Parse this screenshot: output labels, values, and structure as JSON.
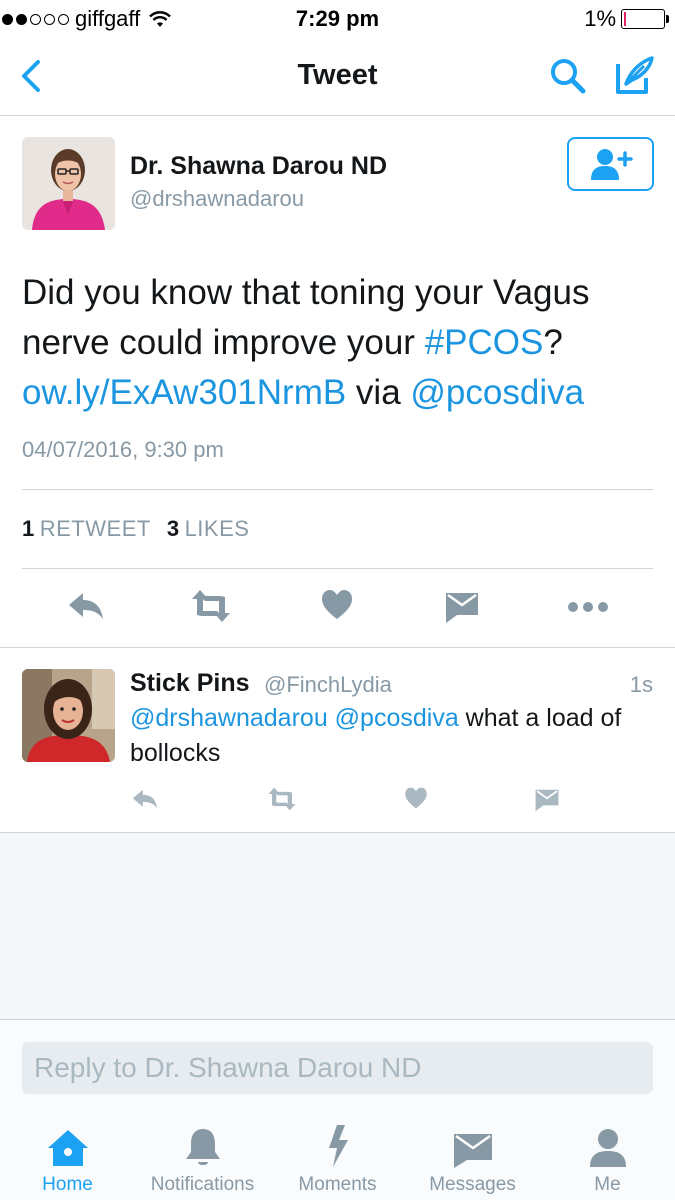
{
  "status_bar": {
    "carrier": "giffgaff",
    "signal_bars": 2,
    "time": "7:29 pm",
    "battery": "1%",
    "battery_level": 0.01
  },
  "nav": {
    "title": "Tweet",
    "back_icon": "chevron-left-icon",
    "search_icon": "search-icon",
    "compose_icon": "compose-icon"
  },
  "tweet": {
    "author_name": "Dr. Shawna Darou ND",
    "author_handle": "@drshawnadarou",
    "text_part1": "Did you know that toning your Vagus nerve could improve your ",
    "hashtag": "#PCOS",
    "text_part2": "? ",
    "link": "ow.ly/ExAw301NrmB",
    "via": " via ",
    "mention": "@pcosdiva",
    "timestamp": "04/07/2016, 9:30 pm",
    "retweet_count": "1",
    "retweet_label": "RETWEET",
    "like_count": "3",
    "like_label": "LIKES"
  },
  "reply": {
    "name": "Stick Pins",
    "handle": "@FinchLydia",
    "time": "1s",
    "mention1": "@drshawnadarou",
    "mention2": "@pcosdiva",
    "text": " what a load of bollocks"
  },
  "reply_box": {
    "placeholder": "Reply to Dr. Shawna Darou ND"
  },
  "tabs": [
    {
      "label": "Home",
      "icon": "home-icon",
      "active": true
    },
    {
      "label": "Notifications",
      "icon": "bell-icon",
      "active": false
    },
    {
      "label": "Moments",
      "icon": "lightning-icon",
      "active": false
    },
    {
      "label": "Messages",
      "icon": "envelope-icon",
      "active": false
    },
    {
      "label": "Me",
      "icon": "person-icon",
      "active": false
    }
  ],
  "colors": {
    "accent": "#1da1f2",
    "link": "#1b95e0",
    "muted": "#8899a6",
    "battery_low": "#e0245e"
  }
}
